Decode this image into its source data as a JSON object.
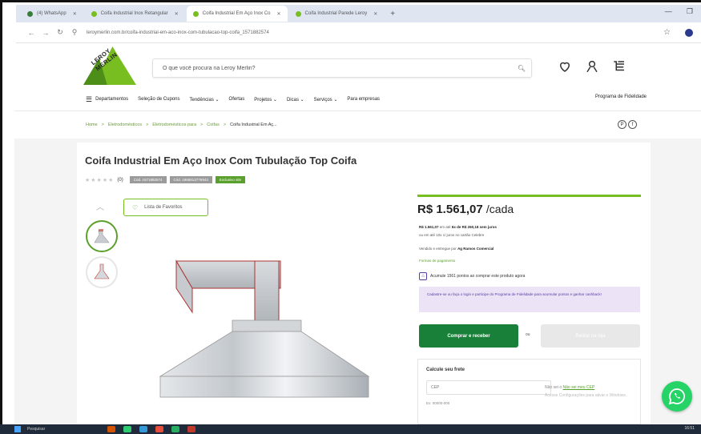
{
  "browser": {
    "tabs": [
      {
        "label": "(4) WhatsApp",
        "active": false
      },
      {
        "label": "Coifa Industrial Inox Retangular",
        "active": false
      },
      {
        "label": "Coifa Industrial Em Aço Inox Co",
        "active": true
      },
      {
        "label": "Coifa Industrial Parede Leroy",
        "active": false
      }
    ],
    "new_tab": "+",
    "url": "leroymerlin.com.br/coifa-industrial-em-aco-inox-com-tubulacao-top-coifa_1571882574"
  },
  "header": {
    "logo_text": "LEROY MERLIN",
    "search_placeholder": "O que você procura na Leroy Merlin?",
    "icons": [
      "heart-icon",
      "user-icon",
      "cart-icon"
    ]
  },
  "menu": {
    "items": [
      "Departamentos",
      "Seleção de Cupons",
      "Tendências ⌄",
      "Ofertas",
      "Projetos ⌄",
      "Dicas ⌄",
      "Serviços ⌄",
      "Para empresas"
    ],
    "right": "Programa de Fidelidade"
  },
  "breadcrumb": {
    "items": [
      "Home",
      ">",
      "Eletrodomésticos",
      ">",
      "Eletrodomésticos para",
      ">",
      "Coifas",
      ">"
    ],
    "current": "Coifa Industrial Em Aç..."
  },
  "product": {
    "title": "Coifa Industrial Em Aço Inox Com Tubulação Top Coifa",
    "stars": "★★★★★",
    "reviews": "(0)",
    "badges": [
      "Cód. 1571882574",
      "Cód. 1968813776943",
      "Exclusivo site"
    ],
    "favorite_label": "Lista de Favoritos"
  },
  "buybox": {
    "price": "R$ 1.561,07",
    "unit": "/cada",
    "price_line_bold": "R$ 1.561,07",
    "price_line_rest": "em até",
    "installments": "6x de R$ 260,18 sem juros",
    "card_line": "ou em até 10x c/ juros no cartão Celebre",
    "seller_prefix": "Vendido e entregue por",
    "seller": "Ag Ramos Comercial",
    "payment_link": "Formas de pagamento",
    "points": "Acumule 1561 pontos ao comprar este produto agora",
    "promo": "Cadastre-se ou faça o login e participe do Programa de Fidelidade para acumular pontos e ganhar cashback!",
    "buy_label": "Comprar e receber",
    "or_label": "ou",
    "alt_label": "Retirar na loja"
  },
  "shipping": {
    "title": "Calcule seu frete",
    "cep_placeholder": "CEP",
    "cep_link_prefix": "Não sei o",
    "cep_link": "Não sei meu CEP",
    "example": "Ex: 00000-000"
  },
  "windows_activation": "Acesse Configurações para ativar o Windows.",
  "taskbar": {
    "search": "Pesquisar",
    "tray": "16:51"
  }
}
